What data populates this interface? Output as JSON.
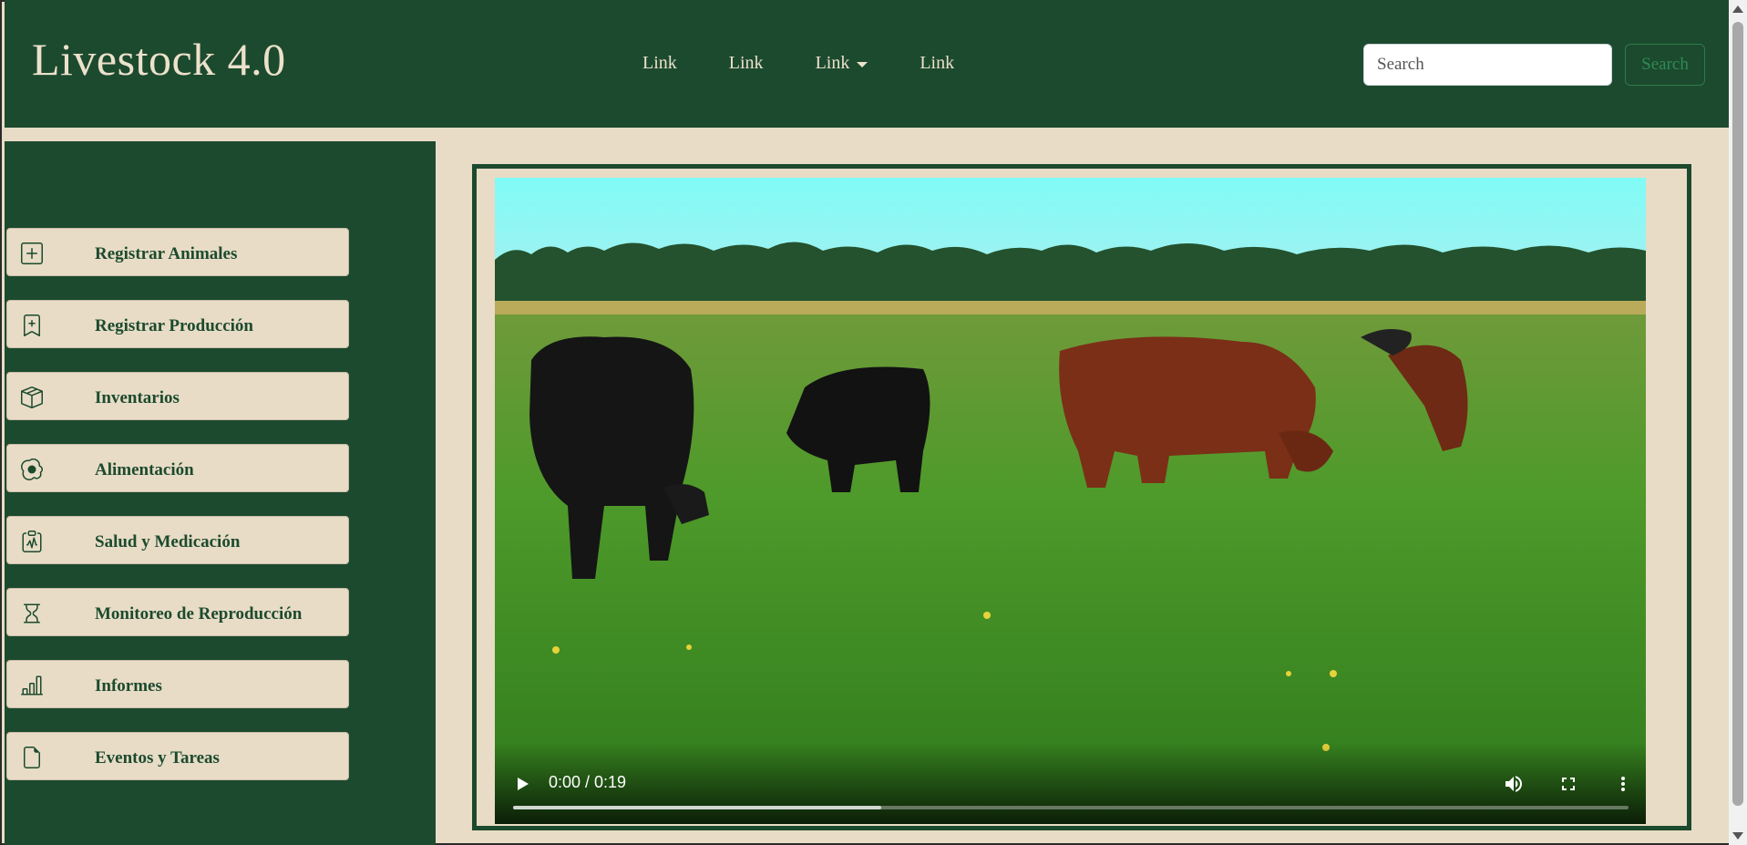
{
  "brand": "Livestock 4.0",
  "nav": {
    "links": [
      "Link",
      "Link",
      "Link",
      "Link"
    ],
    "dropdown_index": 2
  },
  "search": {
    "placeholder": "Search",
    "button_label": "Search"
  },
  "sidebar": {
    "items": [
      {
        "label": "Registrar Animales",
        "icon": "plus-square-icon"
      },
      {
        "label": "Registrar Producción",
        "icon": "bookmark-plus-icon"
      },
      {
        "label": "Inventarios",
        "icon": "box-icon"
      },
      {
        "label": "Alimentación",
        "icon": "egg-fried-icon"
      },
      {
        "label": "Salud y Medicación",
        "icon": "clipboard-pulse-icon"
      },
      {
        "label": "Monitoreo de Reproducción",
        "icon": "hourglass-icon"
      },
      {
        "label": "Informes",
        "icon": "bar-chart-icon"
      },
      {
        "label": "Eventos y Tareas",
        "icon": "file-icon"
      }
    ]
  },
  "video": {
    "time_display": "0:00 / 0:19",
    "current_seconds": 0,
    "duration_seconds": 19,
    "buffered_fraction": 0.33
  },
  "colors": {
    "primary": "#1c4a2e",
    "cream": "#e8dcc6",
    "search_button": "#2f8a55"
  }
}
